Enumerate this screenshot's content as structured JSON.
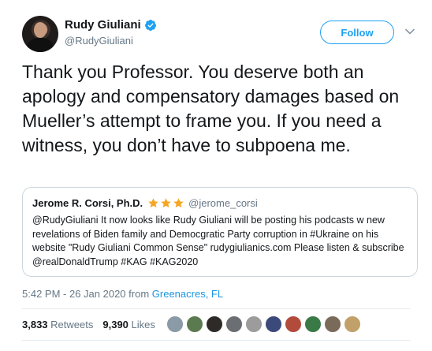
{
  "author": {
    "name": "Rudy Giuliani",
    "handle": "@RudyGiuliani",
    "verified_color": "#1da1f2"
  },
  "follow_button": {
    "label": "Follow"
  },
  "menu": {
    "icon": "chevron-down-icon"
  },
  "tweet": {
    "text": "Thank you Professor. You deserve both an apology and compensatory damages based on Mueller’s attempt to frame you. If you need a witness, you don’t have to subpoena me."
  },
  "quote": {
    "name": "Jerome R. Corsi, Ph.D.",
    "stars": 3,
    "star_color": "#f5a623",
    "handle": "@jerome_corsi",
    "text": "@RudyGiuliani It now looks like Rudy Giuliani will be posting his podcasts w new revelations of Biden family and Democgratic Party corruption in #Ukraine on his website \"Rudy Giuliani Common Sense\" rudygiulianics.com Please listen & subscribe @realDonaldTrump #KAG #KAG2020"
  },
  "meta": {
    "timestamp": "5:42 PM - 26 Jan 2020 from",
    "location": "Greenacres, FL"
  },
  "stats": {
    "retweets_count": "3,833",
    "retweets_label": "Retweets",
    "likes_count": "9,390",
    "likes_label": "Likes"
  },
  "likers": [
    {
      "name": "liker-avatar-1",
      "color": "#8a9aa6"
    },
    {
      "name": "liker-avatar-2",
      "color": "#5c7a4f"
    },
    {
      "name": "liker-avatar-3",
      "color": "#2e2a28"
    },
    {
      "name": "liker-avatar-4",
      "color": "#6b6e72"
    },
    {
      "name": "liker-avatar-5",
      "color": "#9c9c9c"
    },
    {
      "name": "liker-avatar-6",
      "color": "#3b4a7a"
    },
    {
      "name": "liker-avatar-7",
      "color": "#b24b3c"
    },
    {
      "name": "liker-avatar-8",
      "color": "#3a7a46"
    },
    {
      "name": "liker-avatar-9",
      "color": "#7a6a5a"
    },
    {
      "name": "liker-avatar-10",
      "color": "#c2a06a"
    }
  ]
}
